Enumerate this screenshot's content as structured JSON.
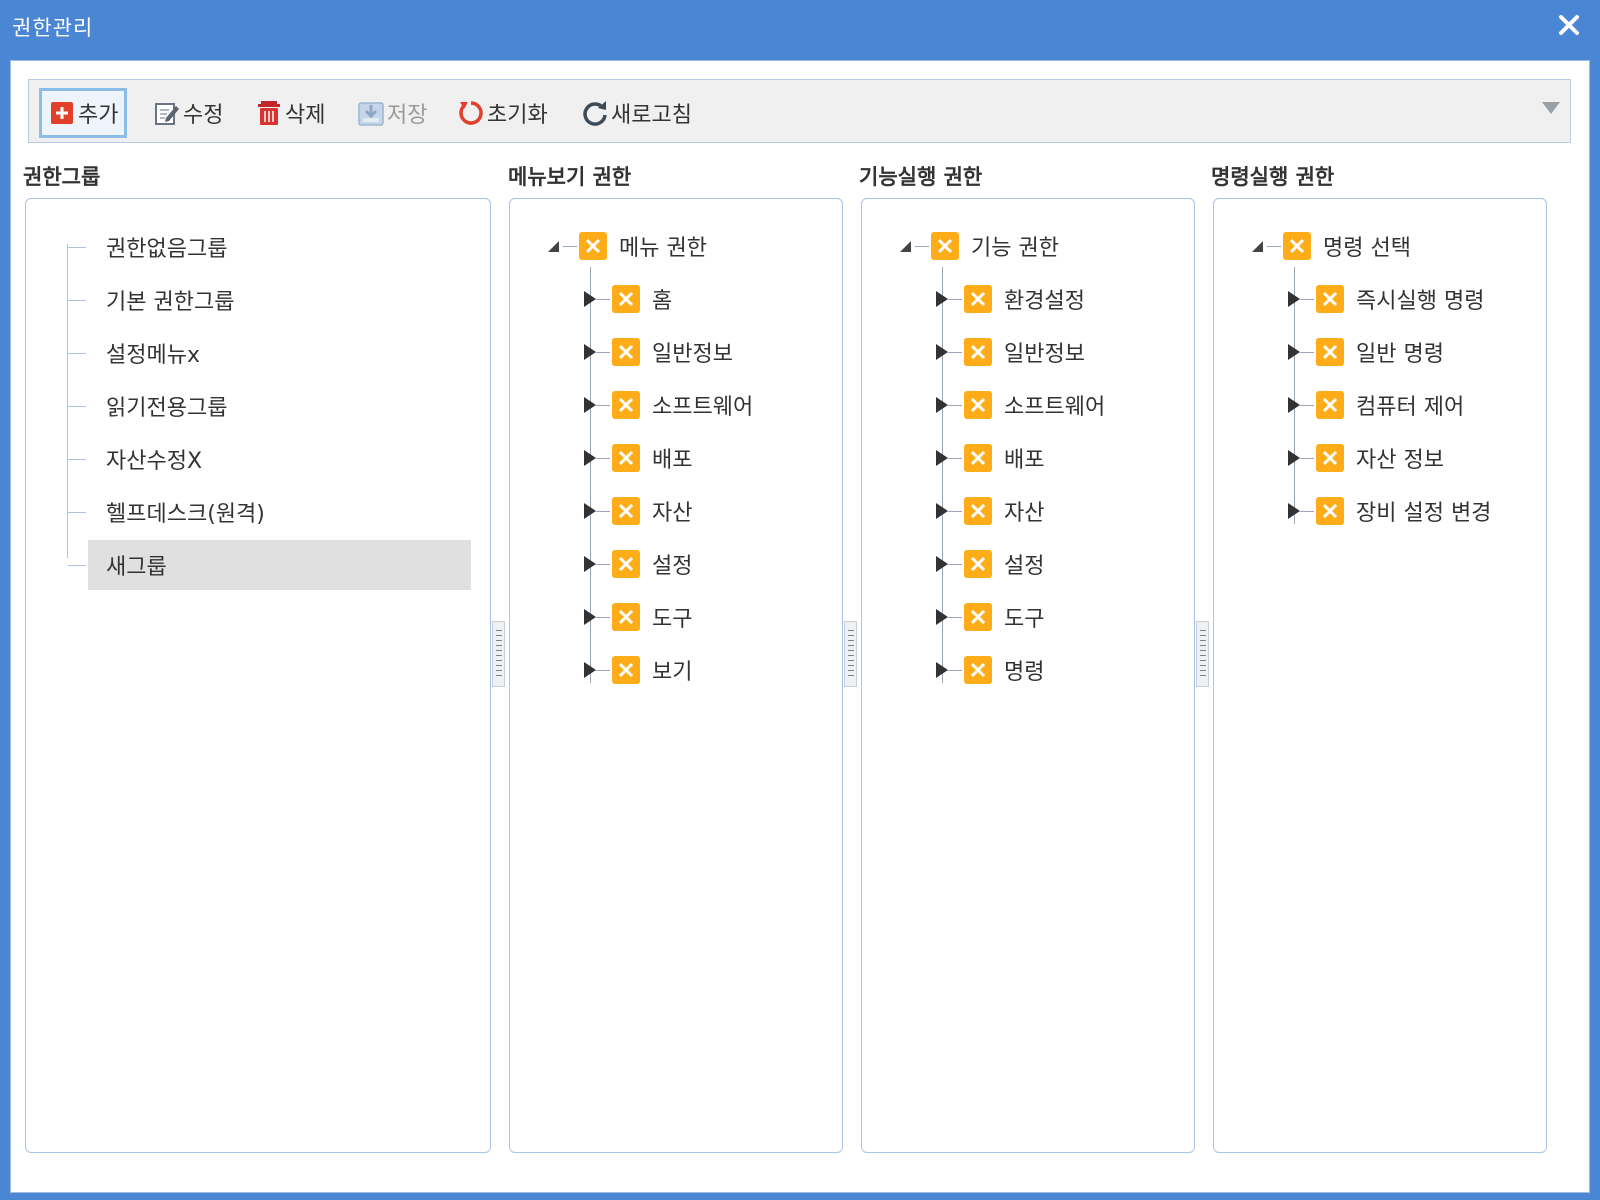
{
  "window": {
    "title": "권한관리"
  },
  "toolbar": {
    "add": "추가",
    "edit": "수정",
    "delete": "삭제",
    "save": "저장",
    "reset": "초기화",
    "refresh": "새로고침"
  },
  "columns": {
    "groups": {
      "header": "권한그룹",
      "items": [
        "권한없음그룹",
        "기본 권한그룹",
        "설정메뉴x",
        "읽기전용그룹",
        "자산수정X",
        "헬프데스크(원격)",
        "새그룹"
      ],
      "selected": "새그룹"
    },
    "menu": {
      "header": "메뉴보기 권한",
      "root": "메뉴 권한",
      "items": [
        "홈",
        "일반정보",
        "소프트웨어",
        "배포",
        "자산",
        "설정",
        "도구",
        "보기"
      ]
    },
    "function": {
      "header": "기능실행 권한",
      "root": "기능 권한",
      "items": [
        "환경설정",
        "일반정보",
        "소프트웨어",
        "배포",
        "자산",
        "설정",
        "도구",
        "명령"
      ]
    },
    "command": {
      "header": "명령실행 권한",
      "root": "명령 선택",
      "items": [
        "즉시실행 명령",
        "일반 명령",
        "컴퓨터 제어",
        "자산 정보",
        "장비 설정 변경"
      ]
    }
  },
  "colors": {
    "titlebar": "#4a86d3",
    "checkbox": "#ffac19",
    "selection": "#e0e0e0"
  }
}
